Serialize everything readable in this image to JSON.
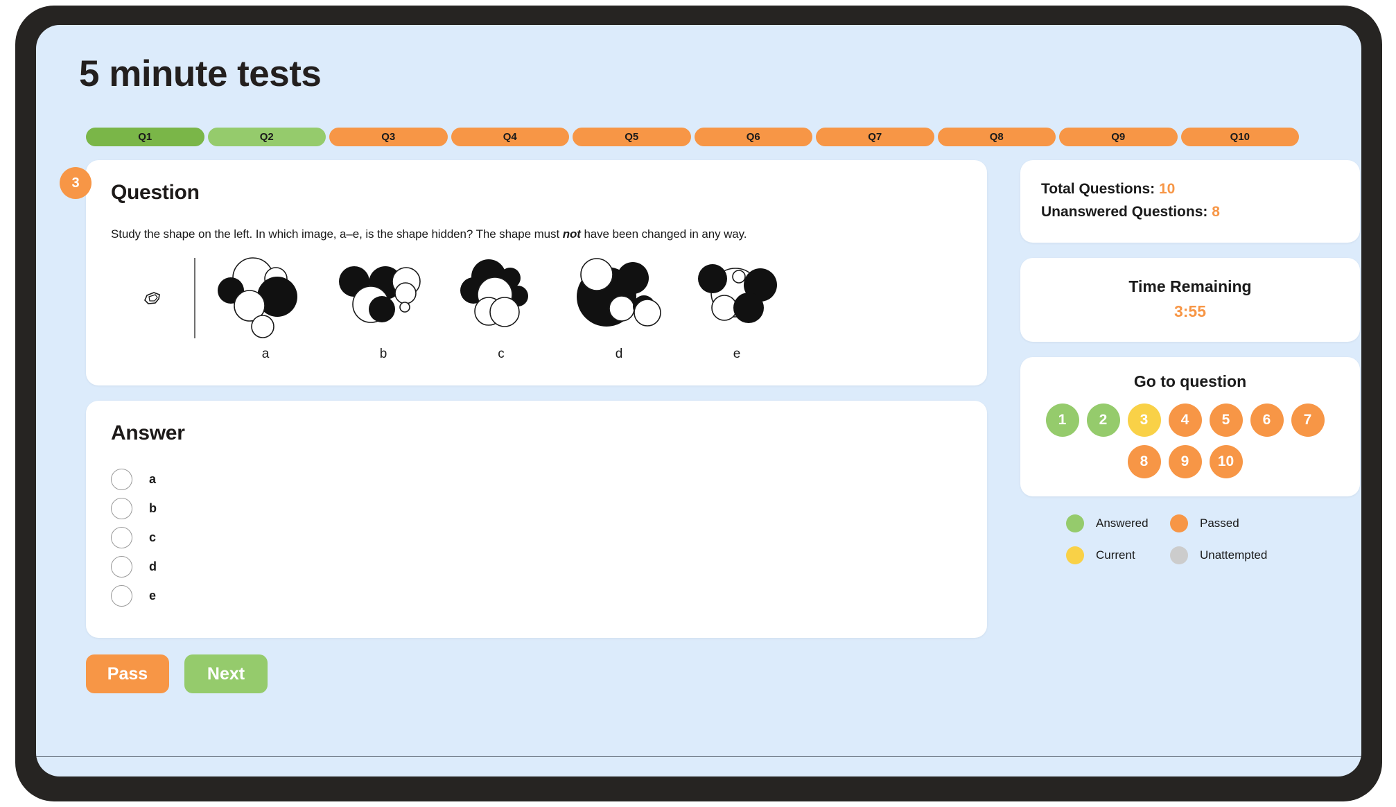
{
  "app": {
    "title": "5 minute tests",
    "background_color": "#dcebfb",
    "bezel_color": "#262422"
  },
  "colors": {
    "answered_green": "#7ab648",
    "answered_green_light": "#95cb6c",
    "passed_orange": "#f79646",
    "current_yellow": "#f9d147",
    "unattempted_grey": "#cccccc"
  },
  "progress_tabs": [
    {
      "label": "Q1",
      "state": "answered",
      "color": "#7ab648"
    },
    {
      "label": "Q2",
      "state": "answered",
      "color": "#95cb6c"
    },
    {
      "label": "Q3",
      "state": "passed",
      "color": "#f79646"
    },
    {
      "label": "Q4",
      "state": "passed",
      "color": "#f79646"
    },
    {
      "label": "Q5",
      "state": "passed",
      "color": "#f79646"
    },
    {
      "label": "Q6",
      "state": "passed",
      "color": "#f79646"
    },
    {
      "label": "Q7",
      "state": "passed",
      "color": "#f79646"
    },
    {
      "label": "Q8",
      "state": "passed",
      "color": "#f79646"
    },
    {
      "label": "Q9",
      "state": "passed",
      "color": "#f79646"
    },
    {
      "label": "Q10",
      "state": "passed",
      "color": "#f79646"
    }
  ],
  "question": {
    "badge_number": "3",
    "heading": "Question",
    "text_before_emphasis": "Study the shape on the left. In which image, a–e, is the shape hidden? The shape must ",
    "emphasis": "not",
    "text_after_emphasis": " have been changed in any way.",
    "reference_shape_label": "",
    "option_labels": [
      "a",
      "b",
      "c",
      "d",
      "e"
    ]
  },
  "answer": {
    "heading": "Answer",
    "options": [
      {
        "label": "a",
        "selected": false
      },
      {
        "label": "b",
        "selected": false
      },
      {
        "label": "c",
        "selected": false
      },
      {
        "label": "d",
        "selected": false
      },
      {
        "label": "e",
        "selected": false
      }
    ]
  },
  "buttons": {
    "pass_label": "Pass",
    "next_label": "Next"
  },
  "stats": {
    "total_questions_label": "Total Questions:",
    "total_questions_value": "10",
    "unanswered_label": "Unanswered Questions:",
    "unanswered_value": "8"
  },
  "timer": {
    "title": "Time Remaining",
    "value": "3:55"
  },
  "goto": {
    "title": "Go to question",
    "items": [
      {
        "label": "1",
        "state": "answered",
        "color": "#95cb6c"
      },
      {
        "label": "2",
        "state": "answered",
        "color": "#95cb6c"
      },
      {
        "label": "3",
        "state": "current",
        "color": "#f9d147"
      },
      {
        "label": "4",
        "state": "passed",
        "color": "#f79646"
      },
      {
        "label": "5",
        "state": "passed",
        "color": "#f79646"
      },
      {
        "label": "6",
        "state": "passed",
        "color": "#f79646"
      },
      {
        "label": "7",
        "state": "passed",
        "color": "#f79646"
      },
      {
        "label": "8",
        "state": "passed",
        "color": "#f79646"
      },
      {
        "label": "9",
        "state": "passed",
        "color": "#f79646"
      },
      {
        "label": "10",
        "state": "passed",
        "color": "#f79646"
      }
    ]
  },
  "legend": [
    {
      "label": "Answered",
      "color": "#95cb6c"
    },
    {
      "label": "Passed",
      "color": "#f79646"
    },
    {
      "label": "Current",
      "color": "#f9d147"
    },
    {
      "label": "Unattempted",
      "color": "#cccccc"
    }
  ]
}
